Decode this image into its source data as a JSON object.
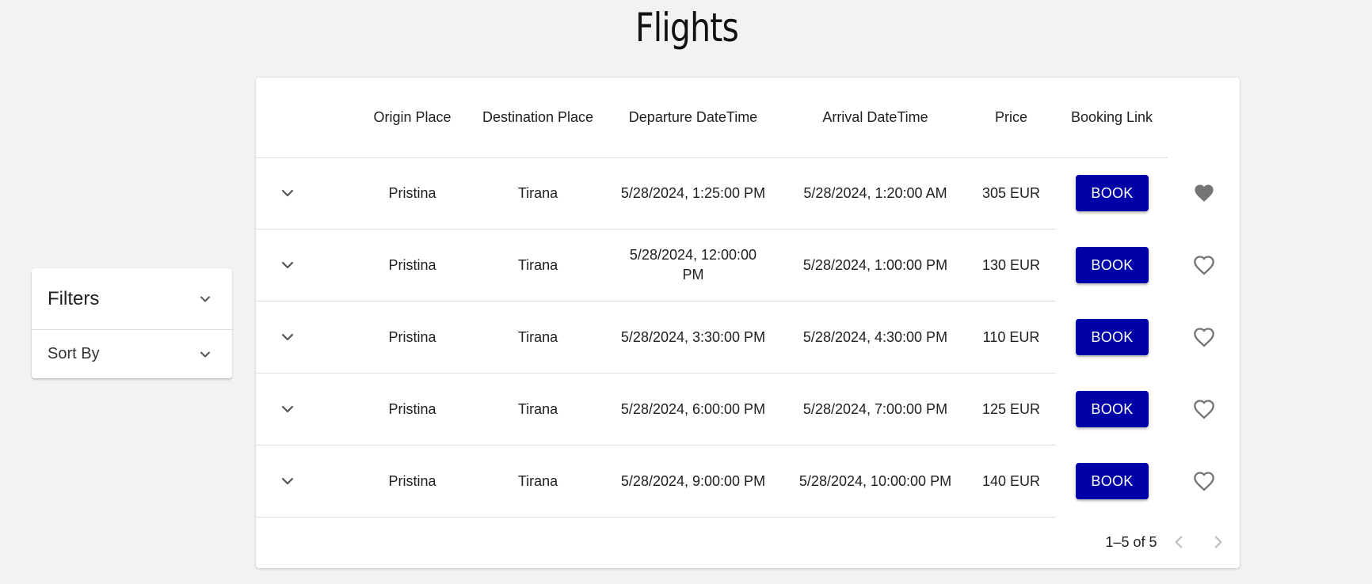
{
  "page": {
    "title": "Flights"
  },
  "sidebar": {
    "filters_label": "Filters",
    "sort_label": "Sort By"
  },
  "table": {
    "headers": {
      "origin": "Origin Place",
      "destination": "Destination Place",
      "departure": "Departure DateTime",
      "arrival": "Arrival DateTime",
      "price": "Price",
      "booking": "Booking Link"
    },
    "book_label": "BOOK",
    "rows": [
      {
        "origin": "Pristina",
        "destination": "Tirana",
        "departure": "5/28/2024, 1:25:00 PM",
        "arrival": "5/28/2024, 1:20:00 AM",
        "price": "305 EUR",
        "favorite": true
      },
      {
        "origin": "Pristina",
        "destination": "Tirana",
        "departure": "5/28/2024, 12:00:00 PM",
        "arrival": "5/28/2024, 1:00:00 PM",
        "price": "130 EUR",
        "favorite": false
      },
      {
        "origin": "Pristina",
        "destination": "Tirana",
        "departure": "5/28/2024, 3:30:00 PM",
        "arrival": "5/28/2024, 4:30:00 PM",
        "price": "110 EUR",
        "favorite": false
      },
      {
        "origin": "Pristina",
        "destination": "Tirana",
        "departure": "5/28/2024, 6:00:00 PM",
        "arrival": "5/28/2024, 7:00:00 PM",
        "price": "125 EUR",
        "favorite": false
      },
      {
        "origin": "Pristina",
        "destination": "Tirana",
        "departure": "5/28/2024, 9:00:00 PM",
        "arrival": "5/28/2024, 10:00:00 PM",
        "price": "140 EUR",
        "favorite": false
      }
    ]
  },
  "pagination": {
    "text": "1–5 of 5"
  },
  "colors": {
    "background": "#f2f2f2",
    "book_button": "#0000a8",
    "icon_gray": "#757575"
  },
  "icons": {
    "expand": "chevron-down-icon",
    "favorite_filled": "heart-filled-icon",
    "favorite_outline": "heart-outline-icon",
    "prev": "chevron-left-icon",
    "next": "chevron-right-icon"
  }
}
